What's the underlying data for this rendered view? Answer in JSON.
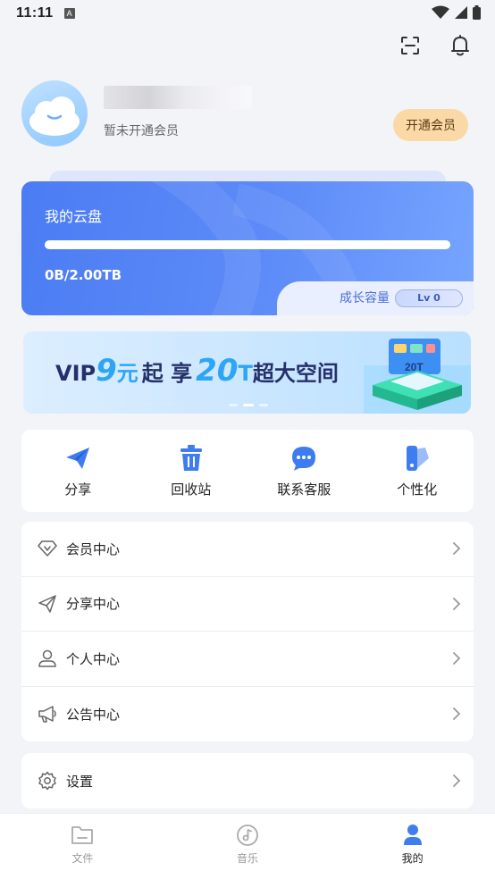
{
  "status_bar": {
    "time": "11:11",
    "notification_icon": "A"
  },
  "top_actions": {
    "scan_icon": "scan-icon",
    "bell_icon": "bell-icon"
  },
  "profile": {
    "member_status": "暂未开通会员",
    "open_vip_label": "开通会员"
  },
  "cloud": {
    "title": "我的云盘",
    "usage": "0B/2.00TB",
    "used_fraction": 0,
    "growth_label": "成长容量",
    "level": "Lv 0"
  },
  "banner": {
    "parts": [
      "VIP",
      "9",
      "元",
      "起 享",
      "20",
      "T",
      "超大空间"
    ],
    "badge_text": "20T",
    "dots": 3,
    "active_dot": 1
  },
  "quick_actions": [
    {
      "label": "分享",
      "icon": "send-icon"
    },
    {
      "label": "回收站",
      "icon": "trash-icon"
    },
    {
      "label": "联系客服",
      "icon": "chat-icon"
    },
    {
      "label": "个性化",
      "icon": "theme-icon"
    }
  ],
  "menu": [
    {
      "label": "会员中心",
      "icon": "vip-diamond-icon"
    },
    {
      "label": "分享中心",
      "icon": "send-outline-icon"
    },
    {
      "label": "个人中心",
      "icon": "person-icon"
    },
    {
      "label": "公告中心",
      "icon": "megaphone-icon"
    }
  ],
  "settings": {
    "label": "设置",
    "icon": "gear-icon"
  },
  "tabs": [
    {
      "label": "文件",
      "icon": "folder-icon",
      "active": false
    },
    {
      "label": "音乐",
      "icon": "music-icon",
      "active": false
    },
    {
      "label": "我的",
      "icon": "person-filled-icon",
      "active": true
    }
  ],
  "colors": {
    "accent": "#4b7cf3",
    "vip_button": "#fbd9a6",
    "banner_number": "#2da6f5"
  }
}
